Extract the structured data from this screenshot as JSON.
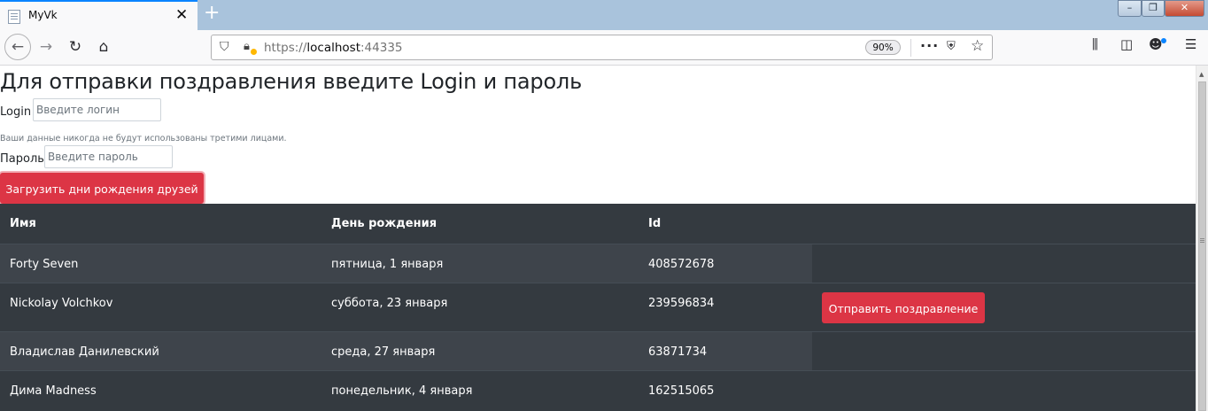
{
  "browser": {
    "tab_title": "MyVk",
    "tab_close": "✕",
    "new_tab": "+",
    "url_prefix": "https://",
    "url_host": "localhost",
    "url_port": ":44335",
    "zoom": "90%",
    "window_controls": {
      "minimize": "–",
      "maximize": "❐",
      "close": "✕"
    },
    "icons": [
      "back-icon",
      "forward-icon",
      "reload-icon",
      "home-icon",
      "shield-icon",
      "lock-warning-icon",
      "page-actions-icon",
      "pocket-icon",
      "bookmark-star-icon",
      "library-icon",
      "sidebar-icon",
      "account-icon",
      "menu-icon"
    ]
  },
  "page": {
    "heading": "Для отправки поздравления введите Login и пароль",
    "login_label": "Login",
    "login_placeholder": "Введите логин",
    "login_value": "",
    "help_text": "Ваши данные никогда не будут использованы третими лицами.",
    "password_label": "Пароль",
    "password_placeholder": "Введите пароль",
    "password_value": "",
    "load_button": "Загрузить дни рождения друзей",
    "accent_color": "#dc3545",
    "table_bg_color": "#343a40"
  },
  "table": {
    "headers": [
      "Имя",
      "День рождения",
      "Id"
    ],
    "rows": [
      {
        "name": "Forty Seven",
        "birthday": "пятница, 1 января",
        "id": "408572678",
        "action": ""
      },
      {
        "name": "Nickolay Volchkov",
        "birthday": "суббота, 23 января",
        "id": "239596834",
        "action": "Отправить поздравление"
      },
      {
        "name": "Владислав Данилевский",
        "birthday": "среда, 27 января",
        "id": "63871734",
        "action": ""
      },
      {
        "name": "Дима Madness",
        "birthday": "понедельник, 4 января",
        "id": "162515065",
        "action": ""
      }
    ]
  }
}
